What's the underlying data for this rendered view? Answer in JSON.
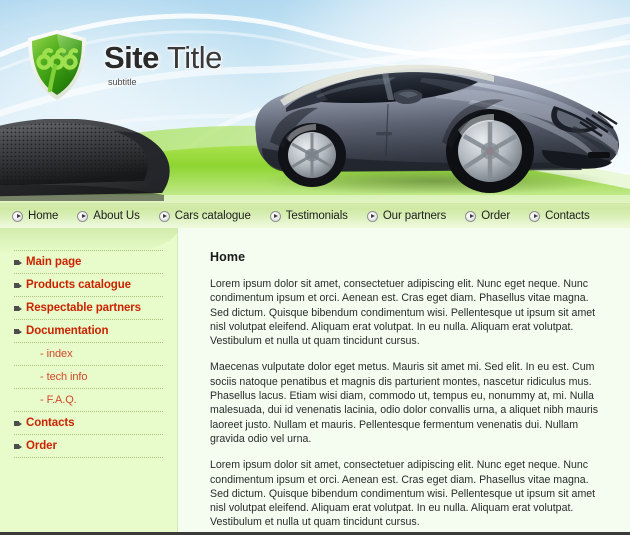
{
  "brand": {
    "title_bold": "Site",
    "title_thin": "Title",
    "subtitle": "subtitle",
    "logo_icon": "green-shield-logo-icon",
    "accent_green": "#7ec220",
    "shield_dark": "#2f7a10"
  },
  "header": {
    "banner_image": "silver-concept-car-photo",
    "mesh_object": "dark-perforated-mesh-object",
    "sky_color": "#bfe0f2",
    "grass_color": "#8ed43a"
  },
  "nav": {
    "items": [
      {
        "label": "Home",
        "icon": "arrow-bullet-icon"
      },
      {
        "label": "About Us",
        "icon": "arrow-bullet-icon"
      },
      {
        "label": "Cars catalogue",
        "icon": "arrow-bullet-icon"
      },
      {
        "label": "Testimonials",
        "icon": "arrow-bullet-icon"
      },
      {
        "label": "Our partners",
        "icon": "arrow-bullet-icon"
      },
      {
        "label": "Order",
        "icon": "arrow-bullet-icon"
      },
      {
        "label": "Contacts",
        "icon": "arrow-bullet-icon"
      }
    ]
  },
  "sidebar": {
    "bg_color": "#e7fcca",
    "link_color": "#cc2200",
    "items": [
      {
        "label": "Main page",
        "sub": false
      },
      {
        "label": "Products catalogue",
        "sub": false
      },
      {
        "label": "Respectable partners",
        "sub": false
      },
      {
        "label": "Documentation",
        "sub": false
      },
      {
        "label": "index",
        "sub": true,
        "dash": "-"
      },
      {
        "label": "tech info",
        "sub": true,
        "dash": "-"
      },
      {
        "label": "F.A.Q.",
        "sub": true,
        "dash": "-"
      },
      {
        "label": "Contacts",
        "sub": false
      },
      {
        "label": "Order",
        "sub": false
      }
    ]
  },
  "main": {
    "title": "Home",
    "paragraphs": [
      "Lorem ipsum dolor sit amet, consectetuer adipiscing elit. Nunc eget neque. Nunc condimentum ipsum et orci. Aenean est. Cras eget diam. Phasellus vitae magna. Sed dictum. Quisque bibendum condimentum wisi. Pellentesque ut ipsum sit amet nisl volutpat eleifend. Aliquam erat volutpat. In eu nulla. Aliquam erat volutpat. Vestibulum et nulla ut quam tincidunt cursus.",
      "Maecenas vulputate dolor eget metus. Mauris sit amet mi. Sed elit. In eu est. Cum sociis natoque penatibus et magnis dis parturient montes, nascetur ridiculus mus. Phasellus lacus. Etiam wisi diam, commodo ut, tempus eu, nonummy at, mi. Nulla malesuada, dui id venenatis lacinia, odio dolor convallis urna, a aliquet nibh mauris laoreet justo. Nullam et mauris. Pellentesque fermentum venenatis dui. Nullam gravida odio vel urna.",
      "Lorem ipsum dolor sit amet, consectetuer adipiscing elit. Nunc eget neque. Nunc condimentum ipsum et orci. Aenean est. Cras eget diam. Phasellus vitae magna. Sed dictum. Quisque bibendum condimentum wisi. Pellentesque ut ipsum sit amet nisl volutpat eleifend. Aliquam erat volutpat. In eu nulla. Aliquam erat volutpat. Vestibulum et nulla ut quam tincidunt cursus."
    ]
  }
}
